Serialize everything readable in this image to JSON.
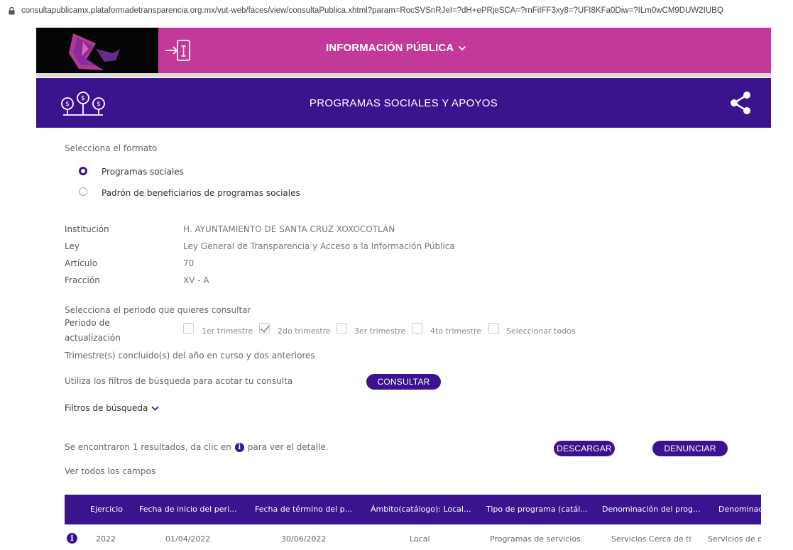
{
  "browser": {
    "url": "consultapublicamx.plataformadetransparencia.org.mx/vut-web/faces/view/consultaPublica.xhtml?param=RocSVSnRJeI=?dH+ePRjeSCA=?rnFiIFF3xy8=?UFI8KFa0Diw=?ILm0wCM9DUW2IUBQ"
  },
  "header": {
    "menu_label": "INFORMACIÓN PÚBLICA",
    "section_title": "PROGRAMAS SOCIALES Y APOYOS"
  },
  "format": {
    "prompt": "Selecciona el formato",
    "options": [
      {
        "label": "Programas sociales",
        "selected": true
      },
      {
        "label": "Padrón de beneficiarios de programas sociales",
        "selected": false
      }
    ]
  },
  "details": [
    {
      "label": "Institución",
      "value": "H. AYUNTAMIENTO DE SANTA CRUZ XOXOCOTLÁN"
    },
    {
      "label": "Ley",
      "value": "Ley General de Transparencia y Acceso a la Información Pública"
    },
    {
      "label": "Artículo",
      "value": "70"
    },
    {
      "label": "Fracción",
      "value": "XV - A"
    }
  ],
  "period": {
    "prompt": "Selecciona el periodo que quieres consultar",
    "label_line1": "Periodo de",
    "label_line2": "actualización",
    "options": [
      {
        "label": "1er trimestre",
        "checked": false
      },
      {
        "label": "2do trimestre",
        "checked": true
      },
      {
        "label": "3er trimestre",
        "checked": false
      },
      {
        "label": "4to trimestre",
        "checked": false
      },
      {
        "label": "Seleccionar todos",
        "checked": false
      }
    ],
    "note": "Trimestre(s) concluido(s) del año en curso y dos anteriores"
  },
  "filters": {
    "hint": "Utiliza los filtros de búsqueda para acotar tu consulta",
    "consult_button": "CONSULTAR",
    "toggle_label": "Filtros de búsqueda"
  },
  "results": {
    "text_before": "Se encontraron 1 resultados, da clic en",
    "text_after": "para ver el detalle.",
    "download_button": "DESCARGAR",
    "report_button": "DENUNCIAR",
    "all_fields_link": "Ver todos los campos"
  },
  "table": {
    "columns": [
      "Ejercicio",
      "Fecha de inicio del peri...",
      "Fecha de término del p...",
      "Ámbito(catálogo): Local...",
      "Tipo de programa (catál...",
      "Denominación del prog...",
      "Denominac"
    ],
    "rows": [
      [
        "2022",
        "01/04/2022",
        "30/06/2022",
        "Local",
        "Programas de servicios",
        "Servicios Cerca de ti",
        "Servicios de c"
      ]
    ]
  },
  "colors": {
    "pink": "#c2399a",
    "purple": "#3c138f"
  }
}
